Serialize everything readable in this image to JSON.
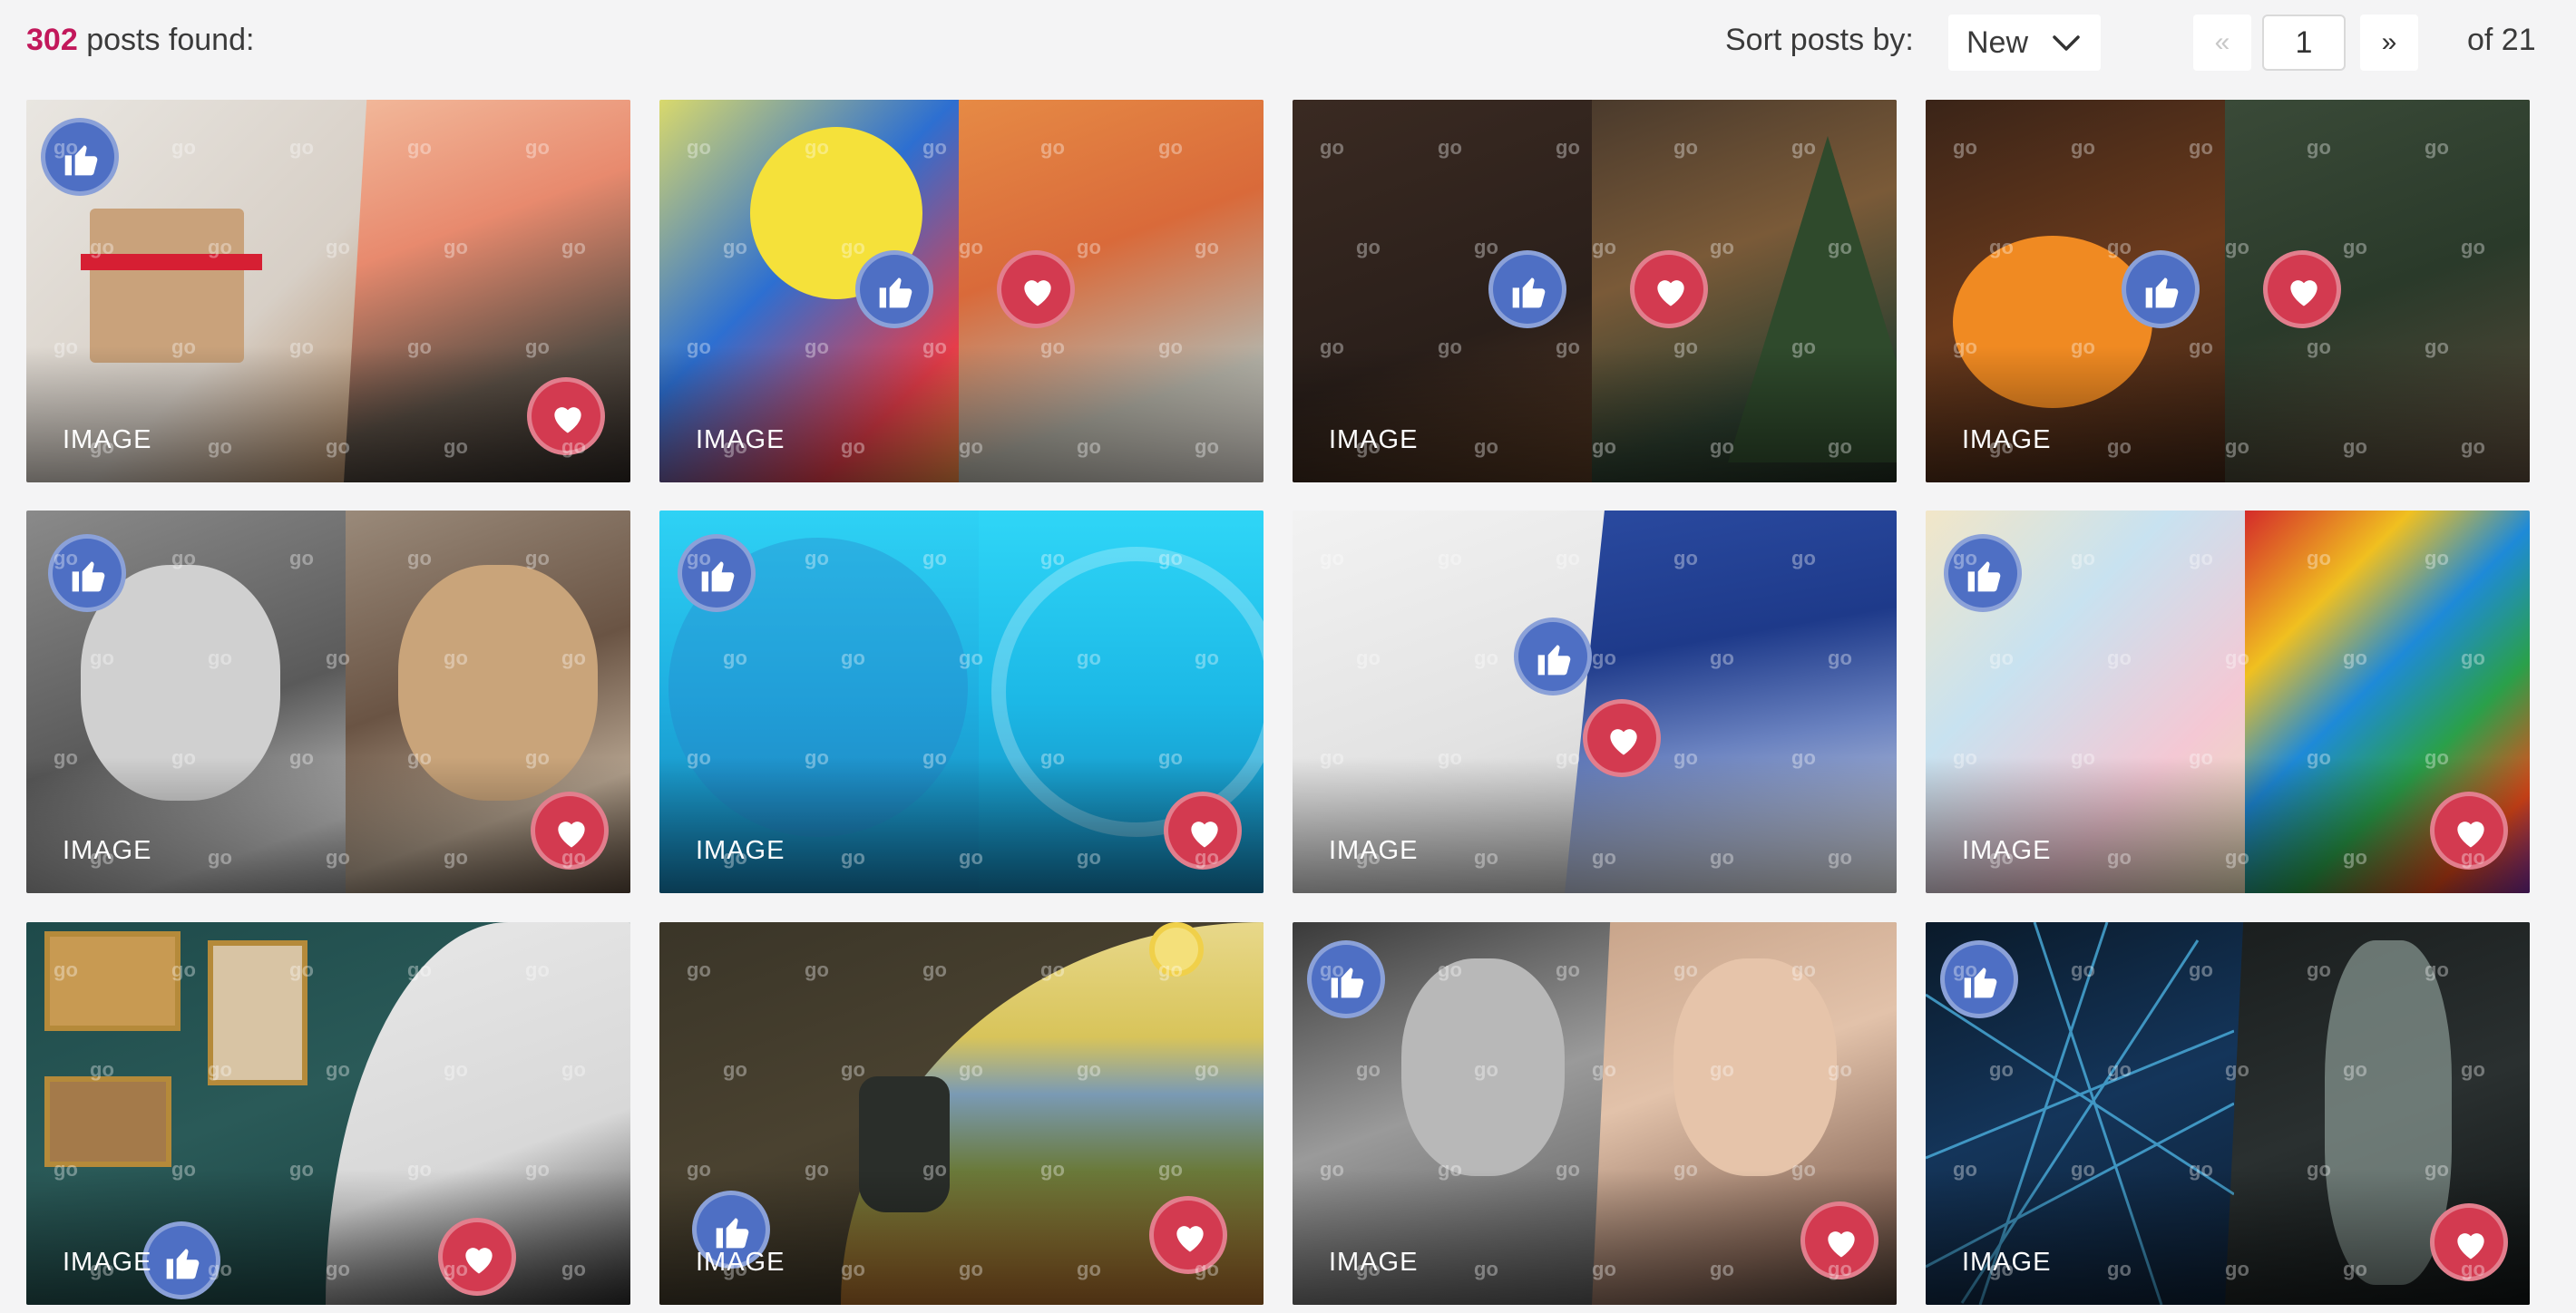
{
  "header": {
    "count_value": "302",
    "count_suffix": "posts found:",
    "sort_label": "Sort posts by:",
    "sort_value": "New",
    "page_first": "«",
    "page_current": "1",
    "page_next": "»",
    "page_of": "of 21"
  },
  "colors": {
    "accent": "#c2185b",
    "like": "#4e6fc4",
    "love": "#d33a50"
  },
  "cards": [
    {
      "label": "IMAGE",
      "left_scene": "gift-box",
      "right_scene": "euro-banknotes"
    },
    {
      "label": "IMAGE",
      "left_scene": "balloons",
      "right_scene": "roses"
    },
    {
      "label": "IMAGE",
      "left_scene": "birthday-cake",
      "right_scene": "christmas-tree"
    },
    {
      "label": "IMAGE",
      "left_scene": "halloween-pumpkin",
      "right_scene": "christmas-ornaments"
    },
    {
      "label": "IMAGE",
      "left_scene": "dog-bw",
      "right_scene": "dog-color"
    },
    {
      "label": "IMAGE",
      "left_scene": "blue-circle",
      "right_scene": "blue-ring"
    },
    {
      "label": "IMAGE",
      "left_scene": "pencil-shavings",
      "right_scene": "blue-paint"
    },
    {
      "label": "IMAGE",
      "left_scene": "marshmallows",
      "right_scene": "jelly-beans"
    },
    {
      "label": "IMAGE",
      "left_scene": "art-gallery-classic",
      "right_scene": "art-gallery-modern"
    },
    {
      "label": "IMAGE",
      "left_scene": "still-life",
      "right_scene": "van-gogh-landscape"
    },
    {
      "label": "IMAGE",
      "left_scene": "woman-portrait-bw",
      "right_scene": "woman-portrait-color"
    },
    {
      "label": "IMAGE",
      "left_scene": "neon-lines",
      "right_scene": "dancer"
    }
  ],
  "watermark": "go"
}
